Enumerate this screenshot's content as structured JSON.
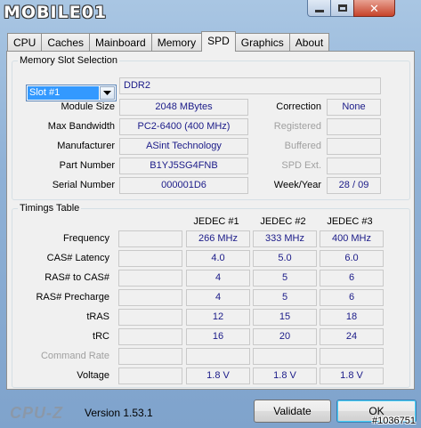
{
  "window": {
    "logo_text": "MOBILE01",
    "close_glyph": "✕"
  },
  "tabs": [
    {
      "label": "CPU"
    },
    {
      "label": "Caches"
    },
    {
      "label": "Mainboard"
    },
    {
      "label": "Memory"
    },
    {
      "label": "SPD",
      "active": true
    },
    {
      "label": "Graphics"
    },
    {
      "label": "About"
    }
  ],
  "memory_slot": {
    "group_title": "Memory Slot Selection",
    "slot_selected": "Slot #1",
    "memory_type": "DDR2",
    "module_size_label": "Module Size",
    "module_size": "2048 MBytes",
    "max_bandwidth_label": "Max Bandwidth",
    "max_bandwidth": "PC2-6400 (400 MHz)",
    "manufacturer_label": "Manufacturer",
    "manufacturer": "ASint Technology",
    "part_number_label": "Part Number",
    "part_number": "B1YJ5SG4FNB",
    "serial_number_label": "Serial Number",
    "serial_number": "000001D6",
    "correction_label": "Correction",
    "correction": "None",
    "registered_label": "Registered",
    "buffered_label": "Buffered",
    "spd_ext_label": "SPD Ext.",
    "week_year_label": "Week/Year",
    "week_year": "28 / 09"
  },
  "timings": {
    "group_title": "Timings Table",
    "columns": [
      "JEDEC #1",
      "JEDEC #2",
      "JEDEC #3"
    ],
    "rows": [
      {
        "label": "Frequency",
        "values": [
          "266 MHz",
          "333 MHz",
          "400 MHz"
        ]
      },
      {
        "label": "CAS# Latency",
        "values": [
          "4.0",
          "5.0",
          "6.0"
        ]
      },
      {
        "label": "RAS# to CAS#",
        "values": [
          "4",
          "5",
          "6"
        ]
      },
      {
        "label": "RAS# Precharge",
        "values": [
          "4",
          "5",
          "6"
        ]
      },
      {
        "label": "tRAS",
        "values": [
          "12",
          "15",
          "18"
        ]
      },
      {
        "label": "tRC",
        "values": [
          "16",
          "20",
          "24"
        ]
      },
      {
        "label": "Command Rate",
        "values": [
          "",
          "",
          ""
        ],
        "dim": true
      },
      {
        "label": "Voltage",
        "values": [
          "1.8 V",
          "1.8 V",
          "1.8 V"
        ]
      }
    ]
  },
  "footer": {
    "brand": "CPU-Z",
    "version": "Version 1.53.1",
    "validate_label": "Validate",
    "ok_label": "OK",
    "stamp": "#1036751"
  }
}
